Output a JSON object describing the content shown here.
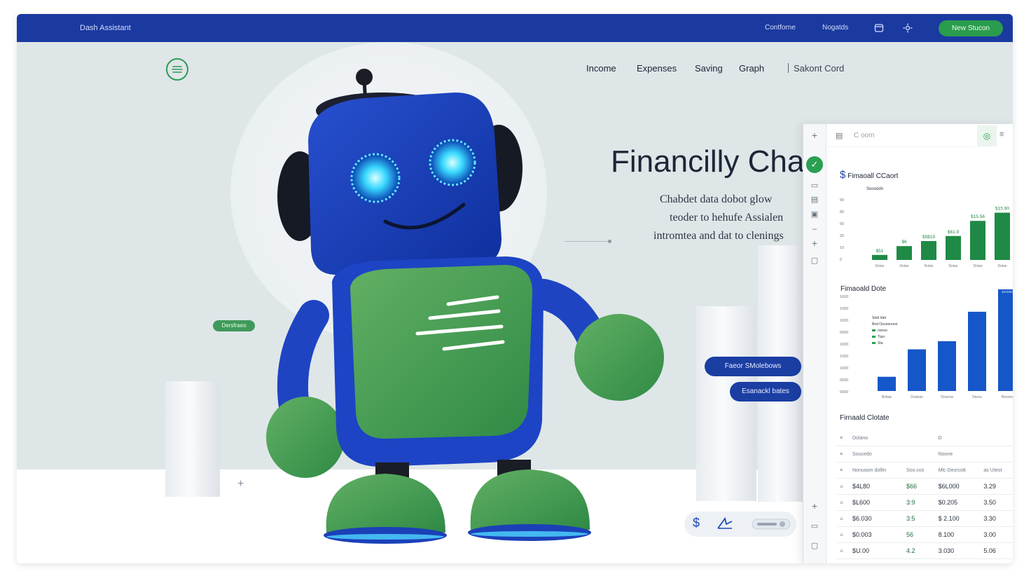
{
  "topbar": {
    "brand": "Dash Assistant",
    "links": [
      "Contforne",
      "Nogatds"
    ],
    "cta": "New Stucon"
  },
  "hero": {
    "nav": [
      "Income",
      "Expenses",
      "Saving",
      "Graph"
    ],
    "nav_extra": "Sakont Cord",
    "title": "Financilly Cha",
    "subtitle_lines": [
      "Chabdet data dobot glow",
      "teoder to hehufe Assialen",
      "intromtea and dat to clenings"
    ],
    "tag": "Dersfraeo",
    "pill_primary": "Faeor SMolebows",
    "pill_secondary": "Esanackl bates"
  },
  "colors": {
    "brand_blue": "#1a3aa0",
    "accent_green": "#2a9c4e",
    "bar_green": "#1f8a45",
    "bar_blue": "#1556c8"
  },
  "panel": {
    "search_placeholder": "C oom",
    "chart1": {
      "title": "Fimaoall CCaort",
      "subtitle": "Soooodn",
      "yticks": [
        "90",
        "80",
        "60",
        "20",
        "10",
        "0"
      ],
      "xlabels": [
        "Dolan",
        "Dolan",
        "Dolan",
        "Dolan",
        "Dolan",
        "Dolan"
      ],
      "data_labels": [
        "$51",
        "$6",
        "$5$19",
        "$61.9",
        "$15.56",
        "$15.90"
      ]
    },
    "chart2": {
      "title": "Fimaoald Dote",
      "legend": [
        "Stod Idet",
        "Bod Ooooonooo",
        "noooo",
        "Trpo",
        "Sta"
      ],
      "yticks": [
        "1000",
        "1000",
        "1000",
        "0000",
        "1000",
        "1000",
        "1000",
        "0500",
        "0000"
      ],
      "xlabels": [
        "Bolaar",
        "Douban",
        "Dounna",
        "Darou",
        "Boooro"
      ],
      "data_label": "$10000"
    },
    "table": {
      "title": "Firnaald Clotate",
      "header": [
        "Dolano",
        "D"
      ],
      "subheader": [
        "Soucedo",
        "Noone"
      ],
      "columns": [
        "Nonusion dolltn",
        "Soo.cos",
        "Mlc Deorcott",
        "as Uteot"
      ],
      "rows": [
        [
          "$4L80",
          "$66",
          "$6L000",
          "3.29"
        ],
        [
          "$L600",
          "3:9",
          "$0.205",
          "3.50"
        ],
        [
          "$6.030",
          "3:5",
          "$ 2.100",
          "3.30"
        ],
        [
          "$0.003",
          "56",
          "8.100",
          "3.00"
        ],
        [
          "$U.00",
          "4.2",
          "3.030",
          "5.06"
        ]
      ]
    }
  }
}
